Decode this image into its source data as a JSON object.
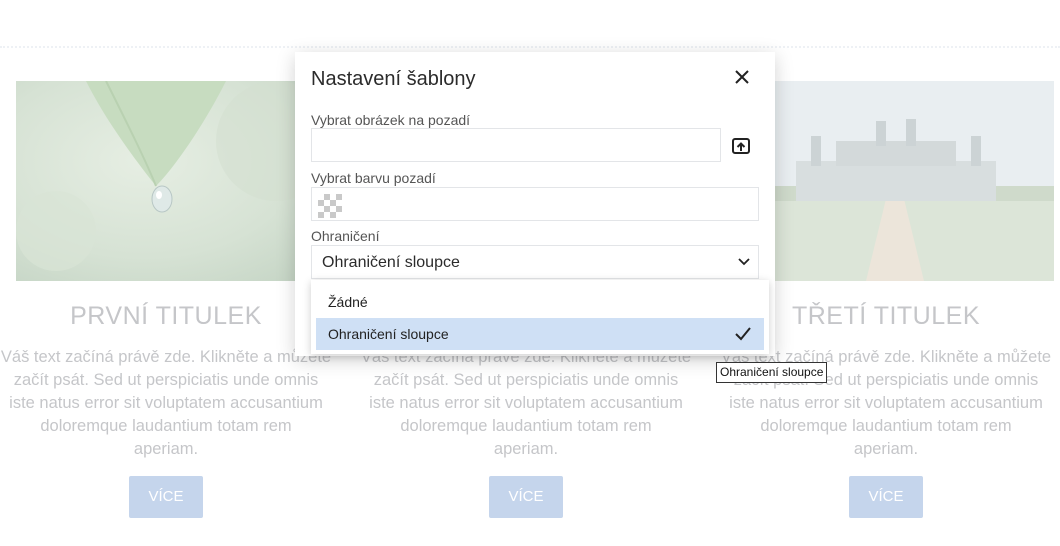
{
  "columns": [
    {
      "title": "PRVNÍ TITULEK",
      "text_lines": [
        "Váš text začíná právě zde. Klikněte a můžete",
        "začít psát. Sed ut perspiciatis unde omnis",
        "iste natus error sit voluptatem accusantium",
        "doloremque laudantium totam rem",
        "aperiam."
      ],
      "button": "VÍCE",
      "image": "leaf-water-drop-image"
    },
    {
      "title": "",
      "text_lines": [
        "Váš text začíná právě zde. Klikněte a můžete",
        "začít psát. Sed ut perspiciatis unde omnis",
        "iste natus error sit voluptatem accusantium",
        "doloremque laudantium totam rem",
        "aperiam."
      ],
      "button": "VÍCE",
      "image": ""
    },
    {
      "title": "TŘETÍ TITULEK",
      "text_lines": [
        "Váš text začíná právě zde. Klikněte a můžete",
        "začít psát. Sed ut perspiciatis unde omnis",
        "iste natus error sit voluptatem accusantium",
        "doloremque laudantium totam rem",
        "aperiam."
      ],
      "button": "VÍCE",
      "image": "chateau-image"
    }
  ],
  "modal": {
    "title": "Nastavení šablony",
    "close_icon": "close-icon",
    "bg_image_label": "Vybrat obrázek na pozadí",
    "bg_image_value": "",
    "upload_icon": "upload-icon",
    "bg_color_label": "Vybrat barvu pozadí",
    "border_label": "Ohraničení",
    "border_selected": "Ohraničení sloupce",
    "border_options": [
      "Žádné",
      "Ohraničení sloupce"
    ]
  },
  "tooltip": "Ohraničení sloupce",
  "colors": {
    "accent_button": "#c5d5ec",
    "selected_option": "#cfe0f5",
    "faded_text": "#c5c6c9"
  }
}
